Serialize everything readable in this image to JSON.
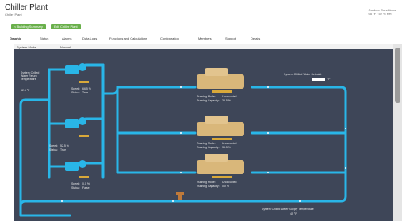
{
  "header": {
    "title": "Chiller Plant",
    "subtitle": "Chiller Plant",
    "outdoor_label": "Outdoor Conditions",
    "outdoor_value": "65 °F / 52 % RH"
  },
  "toolbar": {
    "building_summary": "< Building Summary",
    "edit_chiller_plant": "Edit Chiller Plant"
  },
  "tabs": [
    {
      "label": "Graphic"
    },
    {
      "label": "Status"
    },
    {
      "label": "Alarms"
    },
    {
      "label": "Data Logs"
    },
    {
      "label": "Functions and Calculations"
    },
    {
      "label": "Configuration"
    },
    {
      "label": "Members"
    },
    {
      "label": "Support"
    },
    {
      "label": "Details"
    }
  ],
  "system_bar": {
    "label": "System Mode",
    "value": "Normal"
  },
  "graphic": {
    "return_temp_label": "System Chilled Water Return Temperature",
    "return_temp_value": "52.5 °F",
    "supply_setpoint_label": "System Chilled Water Setpoint",
    "supply_setpoint_unit": "°F",
    "supply_temp_label": "System Chilled Water Supply Temperature",
    "supply_temp_value": "45 °F",
    "pumps": [
      {
        "speed_label": "Speed:",
        "speed": "66.5 %",
        "status_label": "Status:",
        "status": "True"
      },
      {
        "speed_label": "Speed:",
        "speed": "52.5 %",
        "status_label": "Status:",
        "status": "True"
      },
      {
        "speed_label": "Speed:",
        "speed": "0.0 %",
        "status_label": "Status:",
        "status": "False"
      }
    ],
    "chillers": [
      {
        "mode_label": "Running Mode:",
        "mode": "Unoccupied",
        "capacity_label": "Running Capacity:",
        "capacity": "35.5 %"
      },
      {
        "mode_label": "Running Mode:",
        "mode": "Unoccupied",
        "capacity_label": "Running Capacity:",
        "capacity": "35.5 %"
      },
      {
        "mode_label": "Running Mode:",
        "mode": "Unoccupied",
        "capacity_label": "Running Capacity:",
        "capacity": "0.0 %"
      }
    ]
  },
  "colors": {
    "pipe": "#29b6e8",
    "canvas": "#3e4658",
    "chiller": "#d9b77a",
    "button": "#6ab04c"
  }
}
